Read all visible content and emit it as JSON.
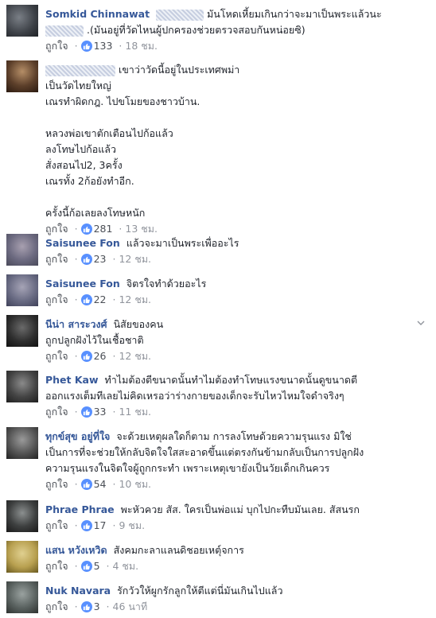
{
  "like_label": "ถูกใจ",
  "comments": [
    {
      "name": "Somkid Chinnawat",
      "lines": [
        "มันโหดเหี้ยมเกินกว่าจะมาเป็นพระแล้วนะ",
        ".(มันอยู่ที่วัดไหนผู้ปกครองช่วยตรวจสอบกันหน่อยซิ)"
      ],
      "likes": "133",
      "time": "18 ชม."
    },
    {
      "name": "",
      "lines": [
        "เขาว่าวัดนี้อยู่ในประเทศพม่า",
        "เป็นวัดไทยใหญ่",
        "เณรทำผิดกฎ. ไปขโมยของชาวบ้าน.",
        "",
        "หลวงพ่อเขาตักเตือนไปก้อแล้ว",
        "ลงโทษไปก้อแล้ว",
        "สั่งสอนไป2, 3ครั้ง",
        "เณรทั้ง 2ก้อยังทำอีก.",
        "",
        "ครั้งนี้ก้อเลยลงโทษหนัก"
      ],
      "likes": "281",
      "time": "13 ชม."
    },
    {
      "name": "Saisunee Fon",
      "lines": [
        "แล้วจะมาเป็นพระเพื่ออะไร"
      ],
      "likes": "23",
      "time": "12 ชม."
    },
    {
      "name": "Saisunee Fon",
      "lines": [
        "จิตรใจทำด้วยอะไร"
      ],
      "likes": "22",
      "time": "12 ชม."
    },
    {
      "name": "นีน่า สาระวงศ์",
      "lines": [
        "นิสัยของคน",
        "ถูกปลูกฝังไว้ในเชื้อชาติ"
      ],
      "likes": "26",
      "time": "12 ชม."
    },
    {
      "name": "Phet Kaw",
      "lines": [
        "ทำไมต้องตีขนาดนั้นทำไมต้องทำโทษแรงขนาดนั้นดูขนาดตี",
        "ออกแรงเต็มทีเลยไม่คิดเหรอว่าร่างกายของเด็กจะรับไหวไหมใจดำจริงๆ"
      ],
      "likes": "33",
      "time": "11 ชม."
    },
    {
      "name": "ทุกข์สุข อยู่ที่ใจ",
      "lines": [
        "จะด้วยเหตุผลใดก็ตาม การลงโทษด้วยความรุนแรง มิใช่",
        "เป็นการที่จะช่วยให้กลับจิตใจใสสะอาดขึ้นแต่ตรงกันข้ามกลับเป็นการปลูกฝัง",
        "ความรุนแรงในจิตใจผู้ถูกกระทำ เพราะเหตุเขายังเป็นวัยเด็กเกินควร"
      ],
      "likes": "54",
      "time": "10 ชม."
    },
    {
      "name": "Phrae Phrae",
      "lines": [
        "พะหัวควย สัส. ใครเป็นพ่อแม่ บุกไปกะทืบมันเลย. สัสนรก"
      ],
      "likes": "17",
      "time": "9 ชม."
    },
    {
      "name": "แสน หวังเหวิด",
      "lines": [
        "สังคมกะลาแลนดิชอยเหตุ์จการ"
      ],
      "likes": "5",
      "time": "4 ชม."
    },
    {
      "name": "Nuk Navara",
      "lines": [
        "รักวัวให้ผูกรักลูกให้ตีแต่นี่มันเกินไปแล้ว"
      ],
      "likes": "3",
      "time": "46 นาที"
    }
  ],
  "colors": {
    "name": "#365899",
    "meta": "#90949c",
    "like_badge": "#5890ff"
  }
}
